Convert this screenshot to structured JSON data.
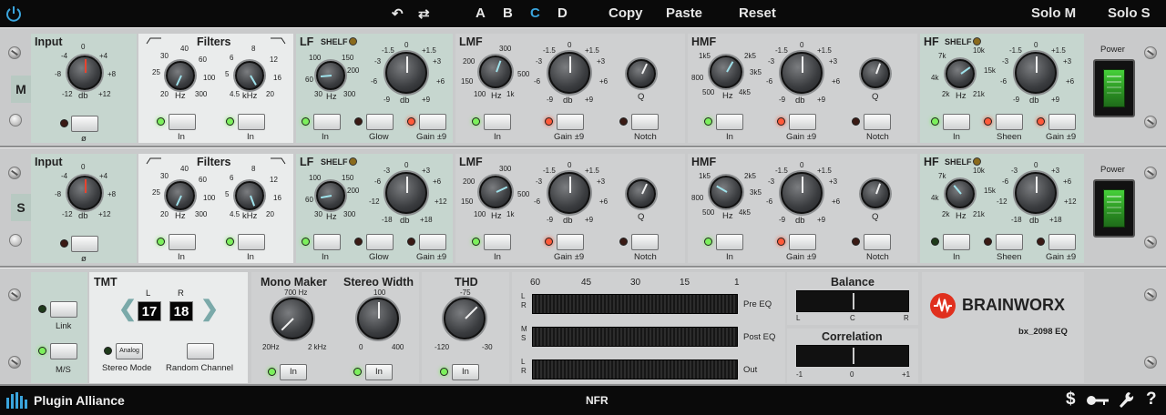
{
  "topbar": {
    "undo_icon": "undo-icon",
    "redo_icon": "redo-icon",
    "presets": [
      "A",
      "B",
      "C",
      "D"
    ],
    "active_preset": "C",
    "copy": "Copy",
    "paste": "Paste",
    "reset": "Reset",
    "solo_m": "Solo M",
    "solo_s": "Solo S"
  },
  "channels": {
    "m": {
      "letter": "M",
      "input": {
        "title": "Input",
        "unit": "db",
        "ticks": [
          "0",
          "-4",
          "+4",
          "-8",
          "+8",
          "-12",
          "+12"
        ],
        "phase": "ø"
      },
      "filters": {
        "title": "Filters",
        "hp_ticks": [
          "40",
          "30",
          "60",
          "25",
          "100",
          "20",
          "300"
        ],
        "hp_unit": "Hz",
        "lp_ticks": [
          "8",
          "6",
          "12",
          "5",
          "16",
          "4.5",
          "20"
        ],
        "lp_unit": "kHz",
        "in1": "In",
        "in2": "In"
      },
      "lf": {
        "title": "LF",
        "shelf": "SHELF",
        "freq_ticks": [
          "100",
          "150",
          "60",
          "200",
          "30",
          "300"
        ],
        "freq_unit": "Hz",
        "gain_ticks": [
          "0",
          "-1.5",
          "+1.5",
          "-3",
          "+3",
          "-6",
          "+6",
          "-9",
          "+9"
        ],
        "gain_unit": "db",
        "in": "In",
        "glow": "Glow",
        "gain9": "Gain ±9"
      },
      "lmf": {
        "title": "LMF",
        "freq_ticks": [
          "300",
          "200",
          "500",
          "150",
          "100",
          "1k"
        ],
        "freq_unit": "Hz",
        "gain_ticks": [
          "0",
          "-1.5",
          "+1.5",
          "-3",
          "+3",
          "-6",
          "+6",
          "-9",
          "+9"
        ],
        "gain_unit": "db",
        "q_unit": "Q",
        "in": "In",
        "gain9": "Gain ±9",
        "notch": "Notch"
      },
      "hmf": {
        "title": "HMF",
        "freq_ticks": [
          "1k5",
          "2k5",
          "800",
          "3k5",
          "500",
          "4k5"
        ],
        "freq_unit": "Hz",
        "gain_ticks": [
          "0",
          "-1.5",
          "+1.5",
          "-3",
          "+3",
          "-6",
          "+6",
          "-9",
          "+9"
        ],
        "gain_unit": "db",
        "q_unit": "Q",
        "in": "In",
        "gain9": "Gain ±9",
        "notch": "Notch"
      },
      "hf": {
        "title": "HF",
        "shelf": "SHELF",
        "freq_ticks": [
          "7k",
          "10k",
          "4k",
          "15k",
          "2k",
          "21k"
        ],
        "freq_unit": "Hz",
        "gain_ticks": [
          "0",
          "-1.5",
          "+1.5",
          "-3",
          "+3",
          "-6",
          "+6",
          "-9",
          "+9"
        ],
        "gain_unit": "db",
        "in": "In",
        "sheen": "Sheen",
        "gain9": "Gain ±9"
      },
      "power": "Power"
    },
    "s": {
      "letter": "S",
      "input": {
        "title": "Input",
        "unit": "db",
        "ticks": [
          "0",
          "-4",
          "+4",
          "-8",
          "+8",
          "-12",
          "+12"
        ],
        "phase": "ø"
      },
      "filters": {
        "title": "Filters",
        "hp_ticks": [
          "40",
          "30",
          "60",
          "25",
          "100",
          "20",
          "300"
        ],
        "hp_unit": "Hz",
        "lp_ticks": [
          "8",
          "6",
          "12",
          "5",
          "16",
          "4.5",
          "20"
        ],
        "lp_unit": "kHz",
        "in1": "In",
        "in2": "In"
      },
      "lf": {
        "title": "LF",
        "shelf": "SHELF",
        "freq_ticks": [
          "100",
          "150",
          "60",
          "200",
          "30",
          "300"
        ],
        "freq_unit": "Hz",
        "gain_ticks": [
          "0",
          "-3",
          "+3",
          "-6",
          "+6",
          "-12",
          "+12",
          "-18",
          "+18"
        ],
        "gain_unit": "db",
        "in": "In",
        "glow": "Glow",
        "gain9": "Gain ±9"
      },
      "lmf": {
        "title": "LMF",
        "freq_ticks": [
          "300",
          "200",
          "500",
          "150",
          "100",
          "1k"
        ],
        "freq_unit": "Hz",
        "gain_ticks": [
          "0",
          "-1.5",
          "+1.5",
          "-3",
          "+3",
          "-6",
          "+6",
          "-9",
          "+9"
        ],
        "gain_unit": "db",
        "q_unit": "Q",
        "in": "In",
        "gain9": "Gain ±9",
        "notch": "Notch"
      },
      "hmf": {
        "title": "HMF",
        "freq_ticks": [
          "1k5",
          "2k5",
          "800",
          "3k5",
          "500",
          "4k5"
        ],
        "freq_unit": "Hz",
        "gain_ticks": [
          "0",
          "-1.5",
          "+1.5",
          "-3",
          "+3",
          "-6",
          "+6",
          "-9",
          "+9"
        ],
        "gain_unit": "db",
        "q_unit": "Q",
        "in": "In",
        "gain9": "Gain ±9",
        "notch": "Notch"
      },
      "hf": {
        "title": "HF",
        "shelf": "SHELF",
        "freq_ticks": [
          "7k",
          "10k",
          "4k",
          "15k",
          "2k",
          "21k"
        ],
        "freq_unit": "Hz",
        "gain_ticks": [
          "0",
          "-3",
          "+3",
          "-6",
          "+6",
          "-12",
          "+12",
          "-18",
          "+18"
        ],
        "gain_unit": "db",
        "in": "In",
        "sheen": "Sheen",
        "gain9": "Gain ±9"
      },
      "power": "Power"
    }
  },
  "bottom": {
    "link": "Link",
    "ms": "M/S",
    "tmt": {
      "title": "TMT",
      "l_label": "L",
      "r_label": "R",
      "l_value": "17",
      "r_value": "18",
      "stereo_mode_btn": "Analog",
      "stereo_mode": "Stereo Mode",
      "random_channel": "Random Channel"
    },
    "mono_maker": {
      "title": "Mono Maker",
      "top": "700 Hz",
      "min": "20Hz",
      "max": "2 kHz",
      "in": "In"
    },
    "stereo_width": {
      "title": "Stereo Width",
      "top": "100",
      "min": "0",
      "max": "400",
      "in": "In"
    },
    "thd": {
      "title": "THD",
      "top": "-75",
      "min": "-120",
      "max": "-30",
      "in": "In"
    },
    "meters": {
      "scale": [
        "60",
        "45",
        "30",
        "15",
        "1"
      ],
      "pre_eq": "Pre EQ",
      "post_eq": "Post EQ",
      "out": "Out",
      "ch_l": "L",
      "ch_r": "R",
      "ch_m": "M",
      "ch_s": "S"
    },
    "balance": {
      "title": "Balance",
      "l": "L",
      "c": "C",
      "r": "R"
    },
    "correlation": {
      "title": "Correlation",
      "min": "-1",
      "mid": "0",
      "max": "+1"
    },
    "brand": "BRAINWORX",
    "product": "bx_2098 EQ"
  },
  "botbar": {
    "logo": "Plugin Alliance",
    "license": "NFR"
  },
  "colors": {
    "accent": "#3aa5dd",
    "led_green": "#7cf05c",
    "led_red": "#ff5a3a",
    "panel_green": "#c6d6cf"
  }
}
